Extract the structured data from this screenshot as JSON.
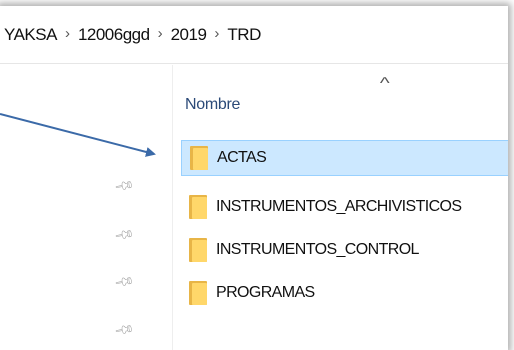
{
  "breadcrumb": {
    "items": [
      "YAKSA",
      "12006ggd",
      "2019",
      "TRD"
    ],
    "separator": "›"
  },
  "column_header": {
    "name_label": "Nombre",
    "sort_indicator": "^"
  },
  "folders": [
    {
      "name": "ACTAS",
      "selected": true
    },
    {
      "name": "INSTRUMENTOS_ARCHIVISTICOS",
      "selected": false
    },
    {
      "name": "INSTRUMENTOS_CONTROL",
      "selected": false
    },
    {
      "name": "PROGRAMAS",
      "selected": false
    }
  ],
  "quick_access": {
    "pin_icon": "pin-icon"
  },
  "colors": {
    "selection_bg": "#cce8ff",
    "selection_border": "#99d1ff",
    "folder_yellow": "#ffd76a",
    "annotation_arrow": "#3b6aa8"
  }
}
